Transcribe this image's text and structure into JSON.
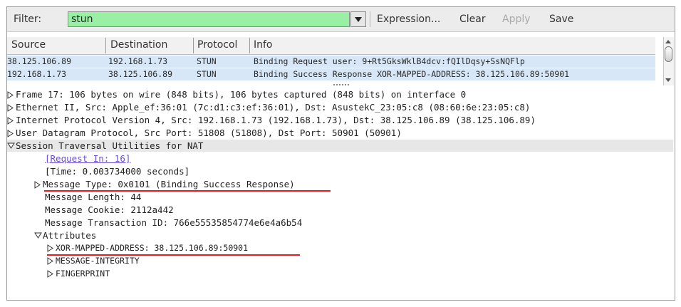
{
  "toolbar": {
    "filter_label": "Filter:",
    "filter_value": "stun",
    "expression_label": "Expression...",
    "clear_label": "Clear",
    "apply_label": "Apply",
    "save_label": "Save"
  },
  "packet_list": {
    "columns": [
      "Source",
      "Destination",
      "Protocol",
      "Info"
    ],
    "rows": [
      {
        "source": "38.125.106.89",
        "destination": "192.168.1.73",
        "protocol": "STUN",
        "info": "Binding Request user: 9+Rt5GksWklB4dcv:fQIlDqsy+SsNQFlp"
      },
      {
        "source": "192.168.1.73",
        "destination": "38.125.106.89",
        "protocol": "STUN",
        "info": "Binding Success Response XOR-MAPPED-ADDRESS: 38.125.106.89:50901"
      }
    ]
  },
  "details": {
    "frame": "Frame 17: 106 bytes on wire (848 bits), 106 bytes captured (848 bits) on interface 0",
    "ethernet": "Ethernet II, Src: Apple_ef:36:01 (7c:d1:c3:ef:36:01), Dst: AsustekC_23:05:c8 (08:60:6e:23:05:c8)",
    "ip": "Internet Protocol Version 4, Src: 192.168.1.73 (192.168.1.73), Dst: 38.125.106.89 (38.125.106.89)",
    "udp": "User Datagram Protocol, Src Port: 51808 (51808), Dst Port: 50901 (50901)",
    "stun": "Session Traversal Utilities for NAT",
    "request_in": "[Request In: 16]",
    "time": "[Time: 0.003734000 seconds]",
    "message_type": "Message Type: 0x0101 (Binding Success Response)",
    "message_length": "Message Length: 44",
    "message_cookie": "Message Cookie: 2112a442",
    "transaction_id": "Message Transaction ID: 766e55535854774e6e4a6b54",
    "attributes": "Attributes",
    "attr_xor": "XOR-MAPPED-ADDRESS: 38.125.106.89:50901",
    "attr_integrity": "MESSAGE-INTEGRITY",
    "attr_fingerprint": "FINGERPRINT"
  },
  "colors": {
    "filter_bg": "#99f0a5",
    "row_bg": "#d7e7f7",
    "link": "#6b4ed9",
    "annotation_underline": "#e02020",
    "selected_line": "#e7e7e7"
  }
}
